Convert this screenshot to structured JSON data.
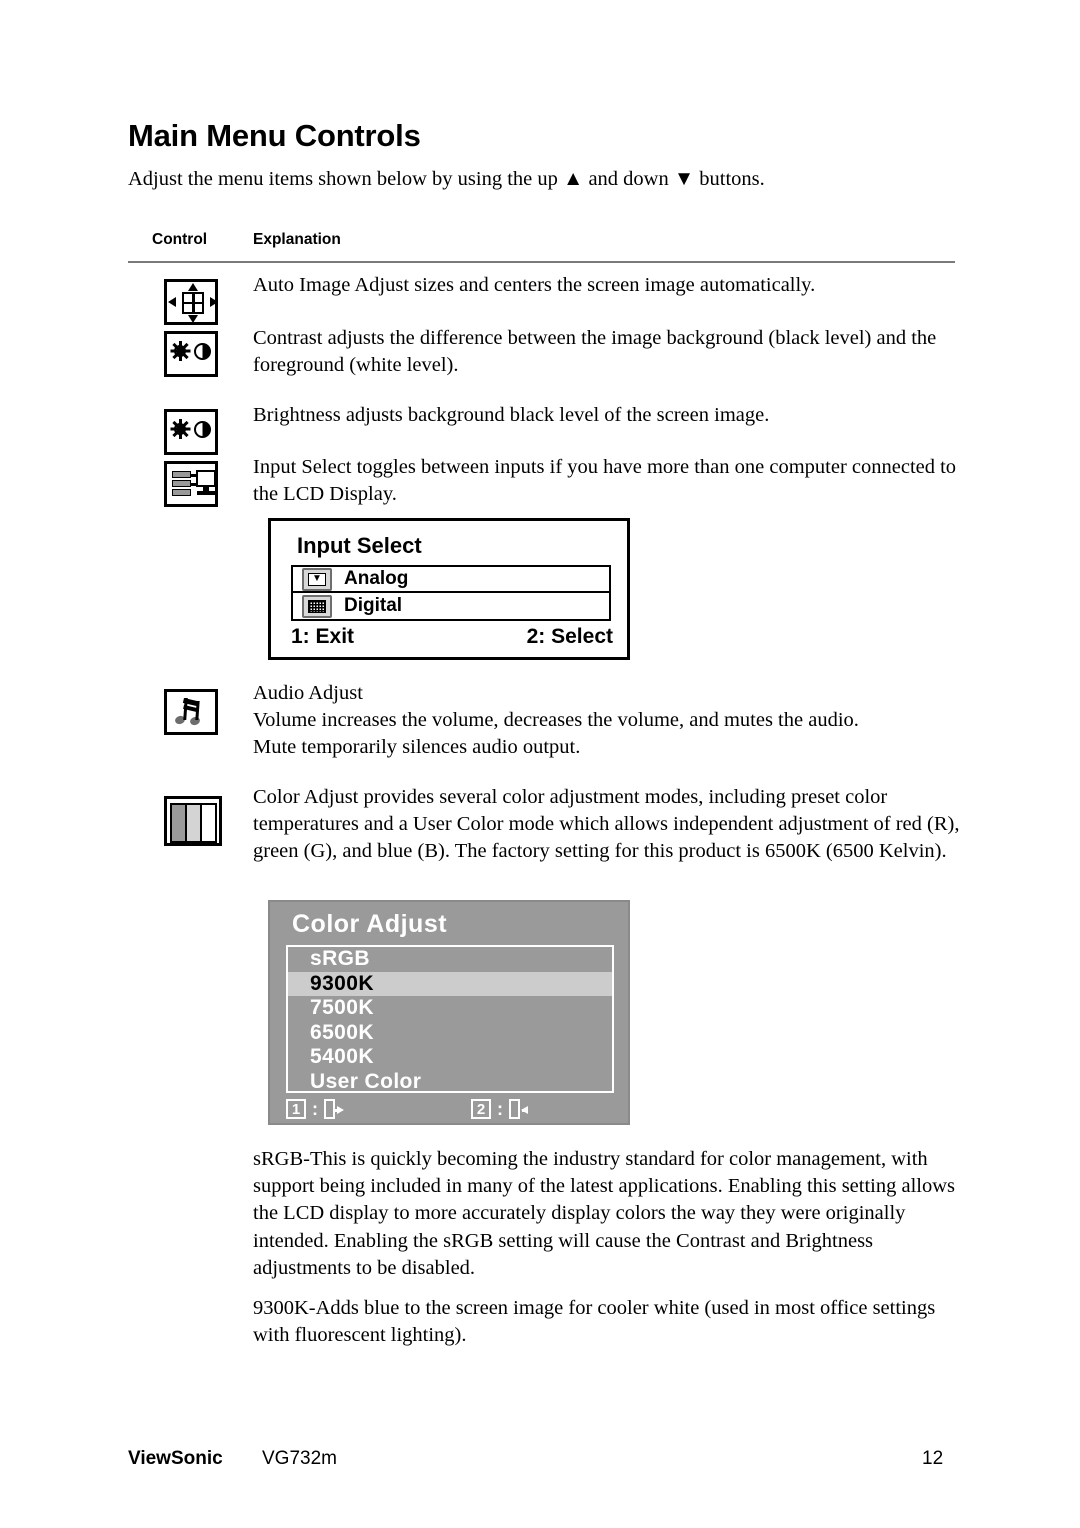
{
  "document": {
    "title": "Main Menu Controls",
    "intro": "Adjust the menu items shown below by using the up ▲ and down ▼ buttons.",
    "table_headers": {
      "control": "Control",
      "explanation": "Explanation"
    }
  },
  "rows": [
    {
      "icon": "auto-image-adjust-icon",
      "text": "Auto Image Adjust sizes and centers the screen image automatically."
    },
    {
      "icon": "contrast-icon",
      "text": "Contrast adjusts the difference between the image background  (black level) and the foreground (white level)."
    },
    {
      "icon": "brightness-icon",
      "text": "Brightness adjusts background black level of the screen image."
    },
    {
      "icon": "input-select-icon",
      "text": "Input Select toggles between inputs if you have more than one computer connected to the LCD Display."
    },
    {
      "icon": "audio-adjust-icon",
      "text": "Audio Adjust\nVolume increases the volume, decreases the volume, and mutes the audio.\nMute temporarily silences audio output."
    },
    {
      "icon": "color-adjust-icon",
      "text": "Color Adjust provides several color adjustment modes, including preset color temperatures and a User Color mode which allows independent adjustment of red (R), green (G), and blue (B). The factory setting for this product is 6500K (6500 Kelvin)."
    }
  ],
  "row_texts": {
    "auto_image_adjust": "Auto Image Adjust sizes and centers the screen image automatically.",
    "contrast": "Contrast adjusts the difference between the image background  (black level) and the foreground (white level).",
    "brightness": "Brightness adjusts background black level of the screen image.",
    "input_select": "Input Select toggles between inputs if you have more than one computer connected to the LCD Display.",
    "audio_title": "Audio Adjust",
    "audio_line1": "Volume increases the volume, decreases the volume, and mutes the audio.",
    "audio_line2": "Mute temporarily silences audio output.",
    "color_adjust": "Color Adjust provides several color adjustment modes, including preset color temperatures and a User Color mode which allows independent adjustment of red (R), green (G), and blue (B). The factory setting for this product is 6500K (6500 Kelvin)."
  },
  "osd_input_select": {
    "title": "Input Select",
    "options": [
      {
        "label": "Analog",
        "icon": "monitor-analog-icon",
        "glyph": "▼"
      },
      {
        "label": "Digital",
        "icon": "monitor-digital-icon",
        "glyph": ""
      }
    ],
    "footer_left": "1: Exit",
    "footer_right": "2: Select"
  },
  "osd_color_adjust": {
    "title": "Color Adjust",
    "options": [
      {
        "label": "sRGB",
        "selected": false
      },
      {
        "label": "9300K",
        "selected": true
      },
      {
        "label": "7500K",
        "selected": false
      },
      {
        "label": "6500K",
        "selected": false
      },
      {
        "label": "5400K",
        "selected": false
      },
      {
        "label": "User Color",
        "selected": false
      }
    ],
    "footer_left_key": "1",
    "footer_left_sep": ":",
    "footer_right_key": "2",
    "footer_right_sep": ":",
    "colors": {
      "background": "#9a9a9a",
      "highlight": "#cccccc",
      "text": "#ffffff",
      "selected_text": "#000000"
    }
  },
  "paragraphs": {
    "srgb": "sRGB-This is quickly becoming the industry standard for color management, with support being included in many of the latest applications. Enabling this setting allows the LCD display to more accurately display colors the way they were originally intended. Enabling the sRGB setting will cause the Contrast and Brightness adjustments to be disabled.",
    "k9300": "9300K-Adds blue to the screen image for cooler white (used in most office settings with fluorescent lighting)."
  },
  "footer": {
    "brand": "ViewSonic",
    "model": "VG732m",
    "page_number": "12"
  }
}
